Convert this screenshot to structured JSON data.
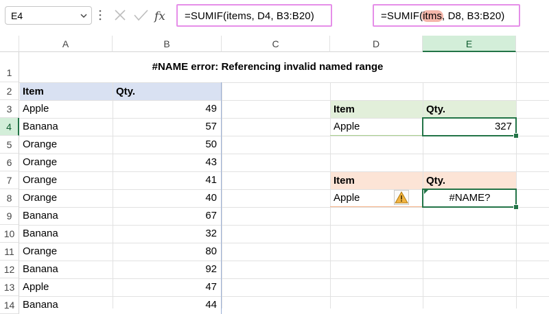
{
  "name_box": {
    "value": "E4"
  },
  "formula_bar": {
    "formula_main": "=SUMIF(items, D4, B3:B20)",
    "formula_alt_prefix": "=SUMIF(",
    "formula_alt_highlight": "itms",
    "formula_alt_suffix": ", D8, B3:B20)",
    "highlight_color": "#f4b6aa"
  },
  "columns": [
    "A",
    "B",
    "C",
    "D",
    "E"
  ],
  "selected_column": "E",
  "rows": [
    "1",
    "2",
    "3",
    "4",
    "5",
    "6",
    "7",
    "8",
    "9",
    "10",
    "11",
    "12",
    "13",
    "14"
  ],
  "selected_row": "4",
  "sheet": {
    "title": "#NAME error: Referencing invalid named range",
    "table_header": {
      "item": "Item",
      "qty": "Qty."
    },
    "table_rows": [
      {
        "item": "Apple",
        "qty": "49"
      },
      {
        "item": "Banana",
        "qty": "57"
      },
      {
        "item": "Orange",
        "qty": "50"
      },
      {
        "item": "Orange",
        "qty": "43"
      },
      {
        "item": "Orange",
        "qty": "41"
      },
      {
        "item": "Orange",
        "qty": "40"
      },
      {
        "item": "Banana",
        "qty": "67"
      },
      {
        "item": "Banana",
        "qty": "32"
      },
      {
        "item": "Orange",
        "qty": "80"
      },
      {
        "item": "Banana",
        "qty": "92"
      },
      {
        "item": "Apple",
        "qty": "47"
      },
      {
        "item": "Banana",
        "qty": "44"
      }
    ],
    "ok_block": {
      "header_item": "Item",
      "header_qty": "Qty.",
      "item": "Apple",
      "result": "327"
    },
    "err_block": {
      "header_item": "Item",
      "header_qty": "Qty.",
      "item": "Apple",
      "result": "#NAME?"
    }
  },
  "colors": {
    "accent": "#217346",
    "table_header": "#d9e1f2",
    "ok_header": "#e2efda",
    "err_header": "#fce4d6",
    "formula_box_border": "#e58ee8",
    "warning": "#e8a33d"
  },
  "icons": [
    "chevron-down-icon",
    "more-vertical-icon",
    "cancel-icon",
    "enter-check-icon",
    "insert-function-icon",
    "warning-icon"
  ]
}
